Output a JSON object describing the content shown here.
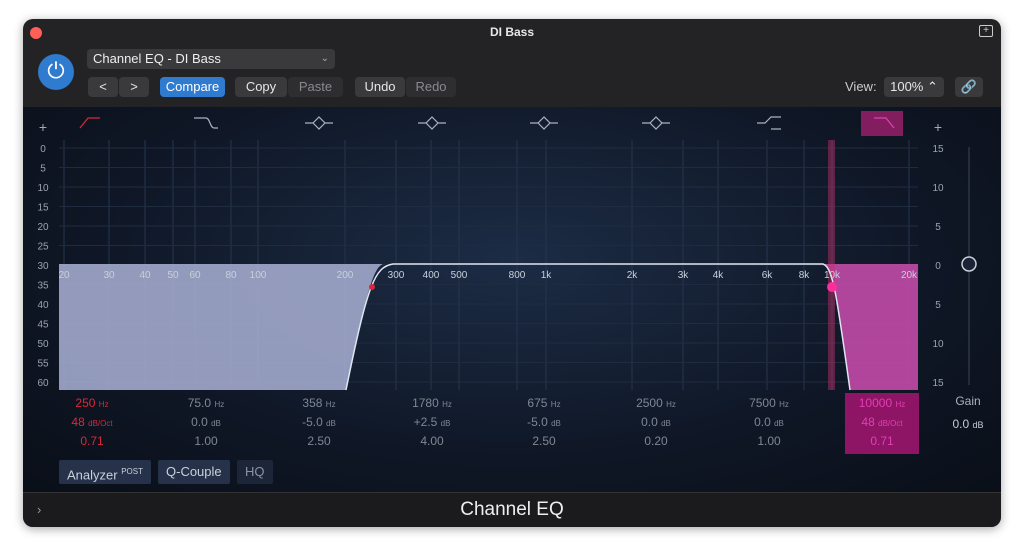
{
  "window": {
    "title": "DI Bass"
  },
  "toolbar": {
    "preset": "Channel EQ - DI Bass",
    "prev": "<",
    "next": ">",
    "compare": "Compare",
    "copy": "Copy",
    "paste": "Paste",
    "undo": "Undo",
    "redo": "Redo",
    "view_label": "View:",
    "view_value": "100%"
  },
  "eq": {
    "left_scale": [
      "0",
      "5",
      "10",
      "15",
      "20",
      "25",
      "30",
      "35",
      "40",
      "45",
      "50",
      "55",
      "60"
    ],
    "right_scale": [
      "15",
      "10",
      "5",
      "0",
      "5",
      "10",
      "15"
    ],
    "freq_labels": [
      "20",
      "30",
      "40",
      "50",
      "60",
      "80",
      "100",
      "200",
      "300",
      "400",
      "500",
      "800",
      "1k",
      "2k",
      "3k",
      "4k",
      "6k",
      "8k",
      "10k",
      "20k"
    ],
    "bands": [
      {
        "type": "low-cut",
        "freq": "250",
        "freq_unit": "Hz",
        "gain": "48",
        "gain_unit": "dB/Oct",
        "q": "0.71",
        "color": "#d8283a"
      },
      {
        "type": "low-shelf",
        "freq": "75.0",
        "freq_unit": "Hz",
        "gain": "0.0",
        "gain_unit": "dB",
        "q": "1.00"
      },
      {
        "type": "bell",
        "freq": "358",
        "freq_unit": "Hz",
        "gain": "-5.0",
        "gain_unit": "dB",
        "q": "2.50"
      },
      {
        "type": "bell",
        "freq": "1780",
        "freq_unit": "Hz",
        "gain": "+2.5",
        "gain_unit": "dB",
        "q": "4.00"
      },
      {
        "type": "bell",
        "freq": "675",
        "freq_unit": "Hz",
        "gain": "-5.0",
        "gain_unit": "dB",
        "q": "2.50"
      },
      {
        "type": "bell",
        "freq": "2500",
        "freq_unit": "Hz",
        "gain": "0.0",
        "gain_unit": "dB",
        "q": "0.20"
      },
      {
        "type": "high-shelf",
        "freq": "7500",
        "freq_unit": "Hz",
        "gain": "0.0",
        "gain_unit": "dB",
        "q": "1.00"
      },
      {
        "type": "high-cut",
        "freq": "10000",
        "freq_unit": "Hz",
        "gain": "48",
        "gain_unit": "dB/Oct",
        "q": "0.71",
        "color": "#e040b0"
      }
    ],
    "gain_label": "Gain",
    "gain_value": "0.0",
    "gain_unit": "dB",
    "analyzer": "Analyzer",
    "analyzer_sup": "POST",
    "qcouple": "Q-Couple",
    "hq": "HQ"
  },
  "footer": {
    "title": "Channel EQ"
  }
}
